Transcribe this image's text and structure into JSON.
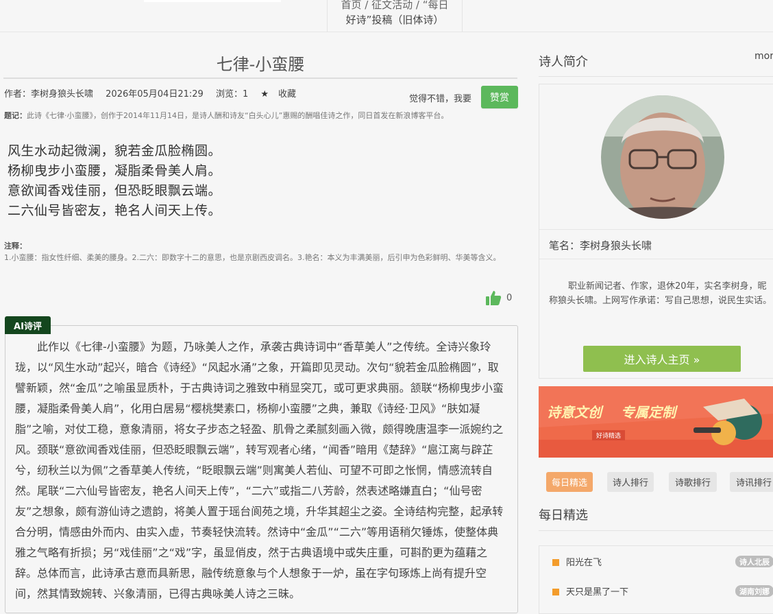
{
  "breadcrumb": {
    "line1": "首页 / 征文活动 / “每日",
    "line2": "好诗”投稿（旧体诗）"
  },
  "poem": {
    "title": "七律-小蛮腰",
    "author": "作者：李树身狼头长啸",
    "datetime": "2026年05月04日21:29",
    "views_label": "浏览：1",
    "favorite_label": "收藏",
    "like_prompt": "觉得不错，我要",
    "reward_button": "赞赏",
    "preface_label": "题记：",
    "preface": "此诗《七律·小蛮腰》，创作于2014年11月14日，是诗人酬和诗友“白头心儿”惠赐的酬唱佳诗之作，同日首发在新浪博客平台。",
    "lines": [
      "风生水动起微澜，貌若金瓜脸椭圆。",
      "杨柳曳步小蛮腰，凝脂柔骨美人肩。",
      "意欲闻香戏佳丽，但恐眨眼飘云端。",
      "二六仙号皆密友，艳名人间天上传。"
    ],
    "notes_label": "注释：",
    "notes": "1.小蛮腰：指女性纤细、柔美的腰身。2.二六：即数字十二的意思，也是京剧西皮调名。3.艳名：本义为丰满美丽，后引申为色彩鲜明、华美等含义。",
    "like_count": "0"
  },
  "ai_review": {
    "tag": "AI诗评",
    "text": "此作以《七律-小蛮腰》为题，乃咏美人之作，承袭古典诗词中“香草美人”之传统。全诗兴象玲珑，以“风生水动”起兴，暗合《诗经》“风起水涌”之象，开篇即见灵动。次句“貌若金瓜脸椭圆”，取譬新颖，然“金瓜”之喻虽显质朴，于古典诗词之雅致中稍显突兀，或可更求典丽。颔联“杨柳曳步小蛮腰，凝脂柔骨美人肩”，化用白居易“樱桃樊素口，杨柳小蛮腰”之典，兼取《诗经·卫风》“肤如凝脂”之喻，对仗工稳，意象清丽，将女子步态之轻盈、肌骨之柔腻刻画入微，颇得晚唐温李一派婉约之风。颈联“意欲闻香戏佳丽，但恐眨眼飘云端”，转写观者心绪，“闻香”暗用《楚辞》“扈江离与辟芷兮，纫秋兰以为佩”之香草美人传统，“眨眼飘云端”则寓美人若仙、可望不可即之怅惘，情感流转自然。尾联“二六仙号皆密友，艳名人间天上传”，“二六”或指二八芳龄，然表述略嫌直白；“仙号密友”之想象，颇有游仙诗之遗韵，将美人置于瑶台阆苑之境，升华其超尘之姿。全诗结构完整，起承转合分明，情感由外而内、由实入虚，节奏轻快流转。然诗中“金瓜”“二六”等用语稍欠锤炼，使整体典雅之气略有折损；另“戏佳丽”之“戏”字，虽显俏皮，然于古典语境中或失庄重，可斟酌更为蕴藉之辞。总体而言，此诗承古意而具新思，融传统意象与个人想象于一炉，虽在字句琢炼上尚有提升空间，然其情致婉转、兴象清丽，已得古典咏美人诗之三昧。"
  },
  "sidebar": {
    "poet_intro_title": "诗人简介",
    "more_label": "more",
    "pen_name": "笔名：李树身狼头长啸",
    "bio": "职业新闻记者、作家，退休20年，实名李树身，昵称狼头长啸。上网写作承诺：写自己思想，说民生实话。",
    "enter_button": "进入诗人主页 »",
    "banner_text_1": "诗意文创",
    "banner_text_2": "专属定制",
    "banner_sub": "好诗精选",
    "tabs": [
      "每日精选",
      "诗人排行",
      "诗歌排行",
      "诗讯排行"
    ],
    "daily_title": "每日精选",
    "daily_items": [
      {
        "title": "阳光在飞",
        "badge": "诗人北辰"
      },
      {
        "title": "天只是黑了一下",
        "badge": "湖南刘娜"
      }
    ]
  },
  "colors": {
    "reward_green": "#5cb85c",
    "enter_green": "#8fbf4f",
    "ai_tag_bg": "#14461e",
    "tab_active": "#f4a86a",
    "banner_bg": "#f27457",
    "list_bullet": "#f39c2b"
  },
  "icons": [
    "star-icon",
    "thumbs-up-icon",
    "double-chevron-right-icon"
  ]
}
